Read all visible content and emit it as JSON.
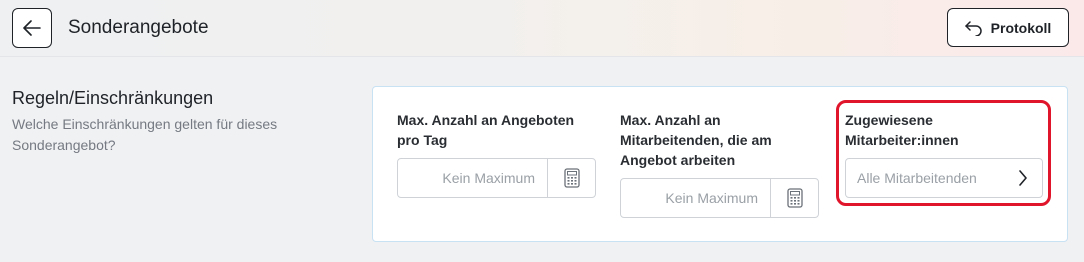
{
  "header": {
    "title": "Sonderangebote",
    "protokoll_label": "Protokoll"
  },
  "section": {
    "heading": "Regeln/Einschränkungen",
    "description": "Welche Einschränkungen gelten für dieses Sonderangebot?"
  },
  "fields": {
    "max_offers": {
      "label": "Max. Anzahl an Angeboten pro Tag",
      "placeholder": "Kein Maximum"
    },
    "max_employees": {
      "label": "Max. Anzahl an Mitarbeitenden, die am Angebot arbeiten",
      "placeholder": "Kein Maximum"
    },
    "assigned": {
      "label": "Zugewiesene Mitarbeiter:innen",
      "value": "Alle Mitarbeitenden"
    }
  },
  "colors": {
    "highlight": "#e0142b",
    "card_border": "#c8e1f3"
  }
}
